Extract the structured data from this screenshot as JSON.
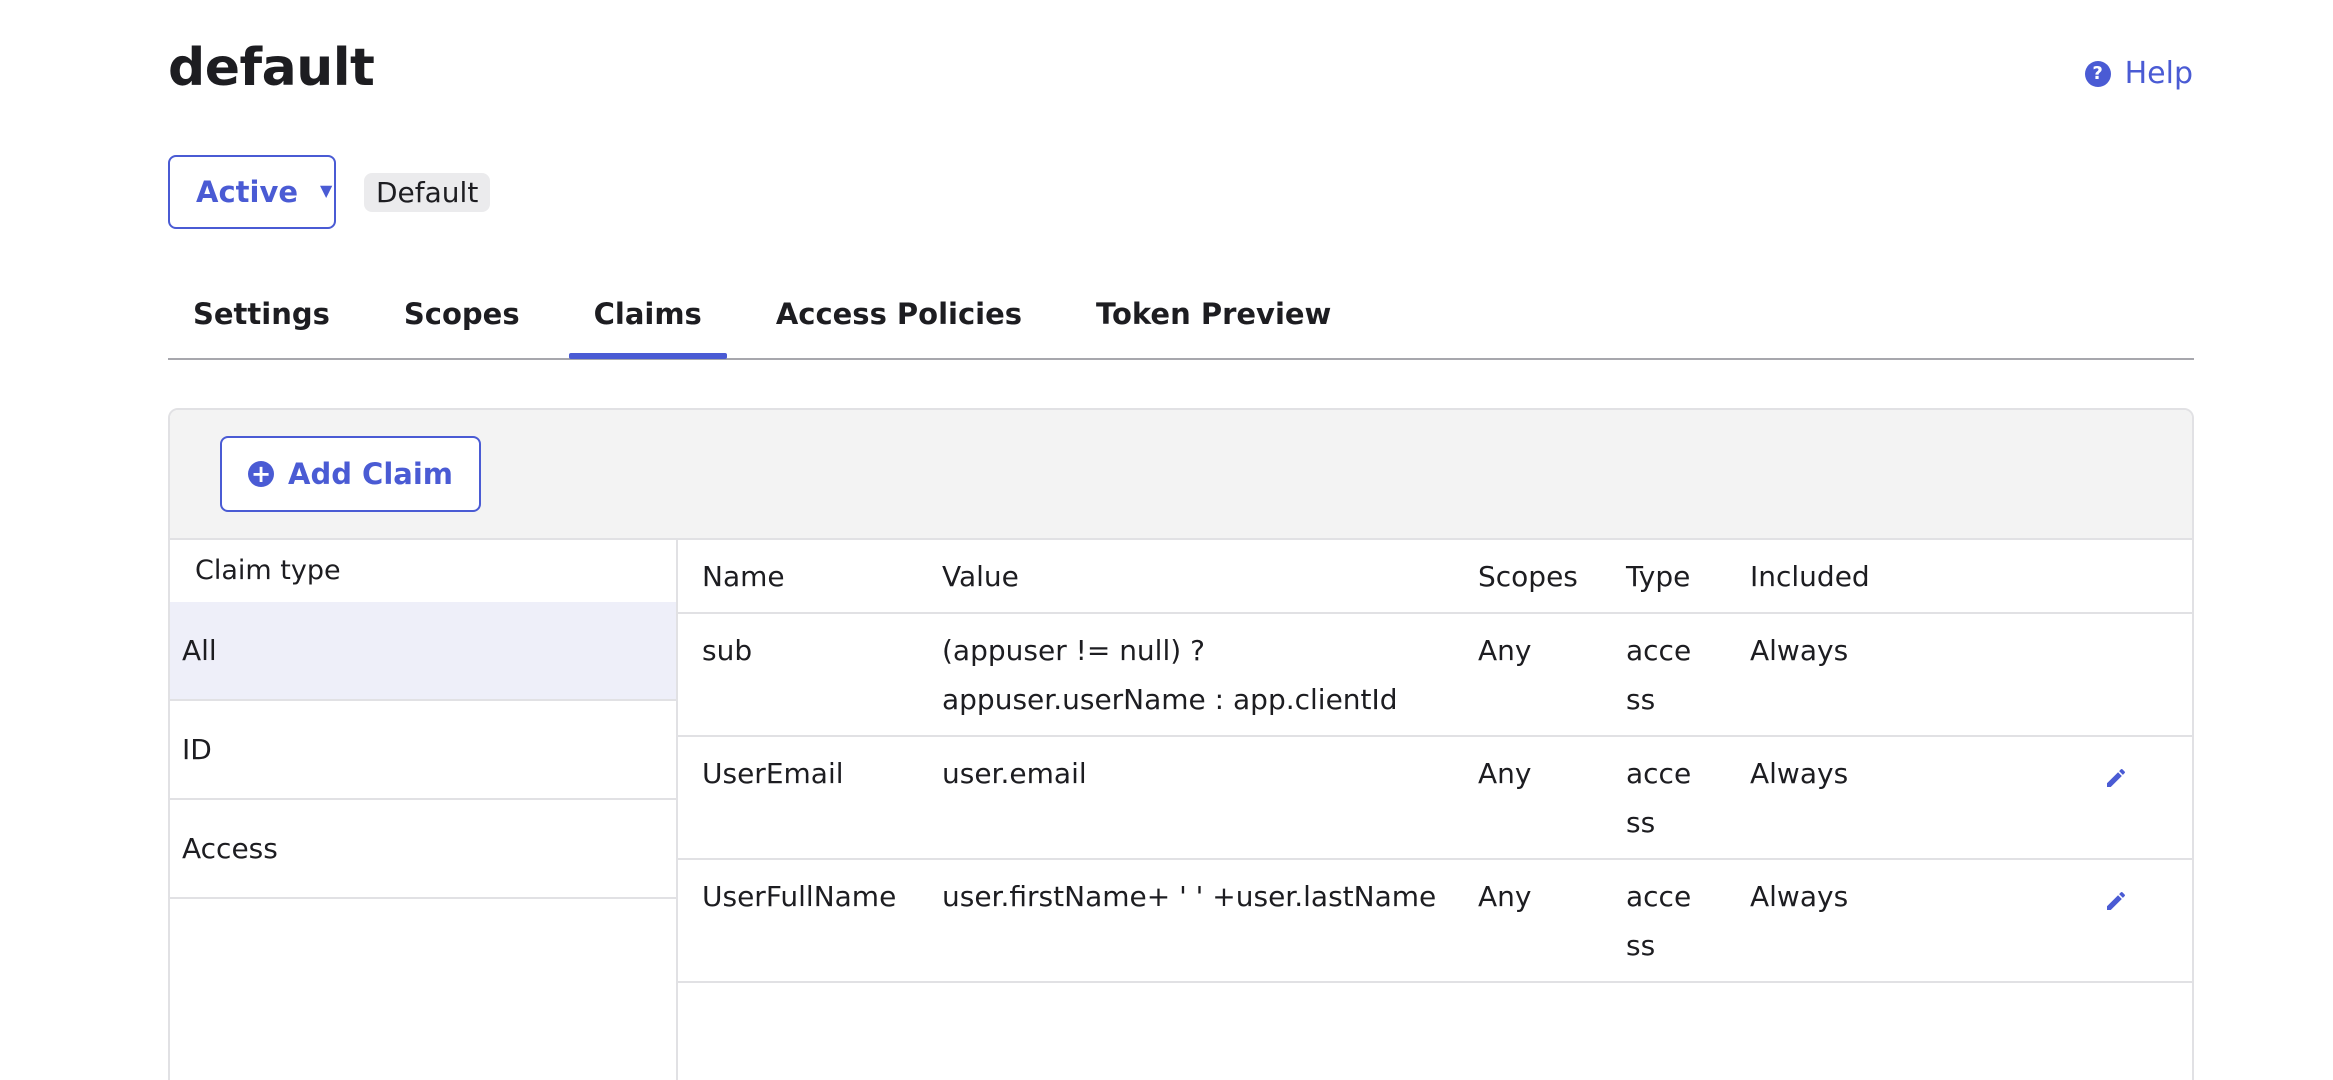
{
  "page": {
    "title": "default",
    "help_label": "Help"
  },
  "status": {
    "selected": "Active",
    "badge": "Default"
  },
  "tabs": [
    {
      "label": "Settings",
      "active": false
    },
    {
      "label": "Scopes",
      "active": false
    },
    {
      "label": "Claims",
      "active": true
    },
    {
      "label": "Access Policies",
      "active": false
    },
    {
      "label": "Token Preview",
      "active": false
    }
  ],
  "toolbar": {
    "add_claim_label": "Add Claim"
  },
  "claim_types": {
    "header": "Claim type",
    "items": [
      {
        "label": "All",
        "selected": true
      },
      {
        "label": "ID",
        "selected": false
      },
      {
        "label": "Access",
        "selected": false
      }
    ]
  },
  "table": {
    "columns": [
      "Name",
      "Value",
      "Scopes",
      "Type",
      "Included"
    ],
    "rows": [
      {
        "name": "sub",
        "value": "(appuser != null) ? appuser.userName : app.clientId",
        "scopes": "Any",
        "type": "access",
        "included": "Always",
        "deletable": false
      },
      {
        "name": "UserEmail",
        "value": "user.email",
        "scopes": "Any",
        "type": "access",
        "included": "Always",
        "deletable": true
      },
      {
        "name": "UserFullName",
        "value": "user.firstName+ ' ' +user.lastName",
        "scopes": "Any",
        "type": "access",
        "included": "Always",
        "deletable": true
      }
    ]
  },
  "colors": {
    "accent": "#4a5bd4",
    "selected_bg": "#eeeff9",
    "header_bg": "#f3f3f3",
    "border": "#e1e1e4"
  },
  "icons": {
    "help": "question-circle-icon",
    "dropdown": "caret-down-icon",
    "add": "plus-circle-icon",
    "edit": "pencil-icon",
    "delete": "close-icon"
  }
}
